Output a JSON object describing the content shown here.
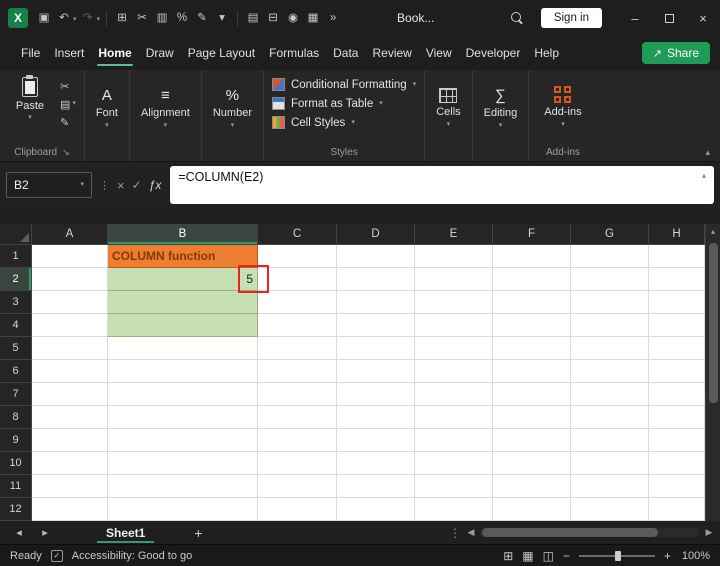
{
  "titlebar": {
    "logo_letter": "X",
    "title": "Book...",
    "sign_in_label": "Sign in",
    "minimize_glyph": "–",
    "close_glyph": "×",
    "qat_icons": [
      {
        "name": "save-icon",
        "glyph": "▣"
      },
      {
        "name": "undo-icon",
        "glyph": "↶",
        "caret": true
      },
      {
        "name": "redo-icon",
        "glyph": "↷",
        "caret": true,
        "dim": true
      },
      {
        "name": "divider"
      },
      {
        "name": "clipboard-icon",
        "glyph": "⊞"
      },
      {
        "name": "cut-icon",
        "glyph": "✂"
      },
      {
        "name": "chart-icon",
        "glyph": "▥"
      },
      {
        "name": "percent-icon",
        "glyph": "%"
      },
      {
        "name": "format-painter-icon",
        "glyph": "✎"
      },
      {
        "name": "dropdown-icon",
        "glyph": "▾"
      },
      {
        "name": "divider"
      },
      {
        "name": "document-icon",
        "glyph": "▤"
      },
      {
        "name": "print-icon",
        "glyph": "⊟"
      },
      {
        "name": "camera-icon",
        "glyph": "◉"
      },
      {
        "name": "table-icon",
        "glyph": "▦"
      },
      {
        "name": "more-commands-icon",
        "glyph": "»"
      }
    ]
  },
  "menubar": {
    "tabs": [
      "File",
      "Insert",
      "Home",
      "Draw",
      "Page Layout",
      "Formulas",
      "Data",
      "Review",
      "View",
      "Developer",
      "Help"
    ],
    "active_tab": "Home",
    "share_label": "Share",
    "share_icon_glyph": "↗"
  },
  "ribbon": {
    "paste_label": "Paste",
    "clipboard_tools": [
      {
        "name": "cut-icon",
        "glyph": "✂"
      },
      {
        "name": "copy-icon",
        "glyph": "▤",
        "caret": true
      },
      {
        "name": "format-painter-icon",
        "glyph": "✎"
      }
    ],
    "clipboard_group_label": "Clipboard",
    "font_label": "Font",
    "font_icon_glyph": "A",
    "alignment_label": "Alignment",
    "alignment_icon_glyph": "≡",
    "number_label": "Number",
    "number_icon_glyph": "%",
    "styles_group_label": "Styles",
    "styles_buttons": [
      "Conditional Formatting",
      "Format as Table",
      "Cell Styles"
    ],
    "cells_label": "Cells",
    "editing_label": "Editing",
    "editing_icon_glyph": "∑",
    "addins_label": "Add-ins",
    "addins_group_label": "Add-ins"
  },
  "formula_bar": {
    "cell_reference": "B2",
    "formula": "=COLUMN(E2)",
    "fx_label": "ƒx"
  },
  "grid": {
    "columns": [
      {
        "label": "A",
        "width": 76
      },
      {
        "label": "B",
        "width": 150
      },
      {
        "label": "C",
        "width": 79
      },
      {
        "label": "D",
        "width": 78
      },
      {
        "label": "E",
        "width": 78
      },
      {
        "label": "F",
        "width": 78
      },
      {
        "label": "G",
        "width": 78
      },
      {
        "label": "H",
        "width": 56
      }
    ],
    "rows": [
      "1",
      "2",
      "3",
      "4",
      "5",
      "6",
      "7",
      "8",
      "9",
      "10",
      "11",
      "12"
    ],
    "selected_column": "B",
    "selected_row": "2",
    "cells": {
      "B1": {
        "text": "COLUMN function",
        "bg": "#ED7D31",
        "color": "#833C00",
        "bold": true,
        "border": "#C55A11"
      },
      "B2": {
        "text": "5",
        "bg": "#C6E0B4",
        "align": "right",
        "border": "#9AAE83"
      },
      "B3": {
        "bg": "#C6E0B4",
        "border": "#9AAE83"
      },
      "B4": {
        "bg": "#C6E0B4",
        "border": "#9AAE83"
      }
    }
  },
  "sheet_bar": {
    "tabs": [
      {
        "label": "Sheet1",
        "active": true
      }
    ],
    "add_label": "+"
  },
  "status_bar": {
    "ready_label": "Ready",
    "accessibility_label": "Accessibility: Good to go",
    "zoom_level": "100%",
    "view_icons": [
      {
        "name": "normal-view-icon",
        "glyph": "⊞"
      },
      {
        "name": "page-layout-view-icon",
        "glyph": "▦"
      },
      {
        "name": "page-break-preview-icon",
        "glyph": "◫"
      }
    ]
  },
  "glyphs": {
    "caret_down": "▾",
    "caret_up": "▴",
    "launcher": "↘",
    "kebab": "⋮",
    "cancel": "×",
    "check": "✓",
    "arrow_up": "▴",
    "tri_left": "◀",
    "tri_right": "▶",
    "tri_left_sm": "◂",
    "tri_right_sm": "▸",
    "minus": "−",
    "plus": "+"
  },
  "colors": {
    "excel_accent_green": "#2E9E68",
    "share_button_green": "#1F9D58",
    "cell_fill_orange": "#ED7D31",
    "cell_fill_green": "#C6E0B4",
    "cell_text_dark_red": "#833C00",
    "annotation_red": "#E8241B"
  }
}
